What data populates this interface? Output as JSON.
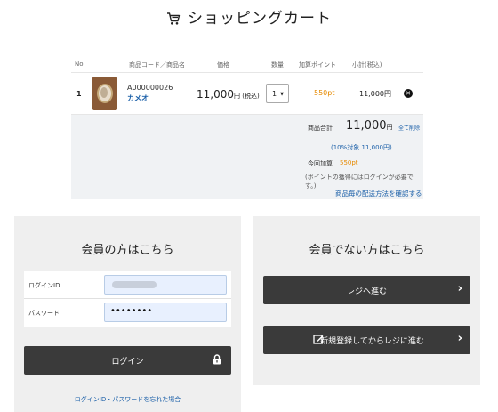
{
  "header": {
    "title": "ショッピングカート",
    "icon": "shopping-cart-icon"
  },
  "cart": {
    "columns": [
      "No.",
      "商品コード／商品名",
      "価格",
      "数量",
      "加算ポイント",
      "小計(税込)"
    ],
    "items": [
      {
        "no": "1",
        "code": "A000000026",
        "name": "カメオ",
        "price": "11,000",
        "price_tax": "円 (税込)",
        "qty": "1",
        "points": "550pt",
        "subtotal": "11,000円"
      }
    ],
    "summary": {
      "total_label": "商品合計",
      "total_value": "11,000",
      "total_unit": "円",
      "delete_all": "全て削除",
      "tax_note": "(10%対象 11,000円)",
      "this_points_label": "今回加算",
      "this_points_value": "550pt",
      "login_note": "(ポイントの獲得にはログインが必要です。)",
      "shipping_link": "商品毎の配送方法を確認する"
    }
  },
  "member": {
    "title": "会員の方はこちら",
    "login_id_label": "ログインID",
    "password_label": "パスワード",
    "password_value": "••••••••",
    "login_button": "ログイン",
    "forgot_link": "ログインID・パスワードを忘れた場合"
  },
  "guest": {
    "title": "会員でない方はこちら",
    "register_button": "レジへ進む",
    "signup_button": "新規登録してからレジに進む"
  },
  "colors": {
    "accent_link": "#1a5fa8",
    "points": "#e68a00",
    "button_dark": "#3a3a3a",
    "panel_bg": "#efefef"
  }
}
